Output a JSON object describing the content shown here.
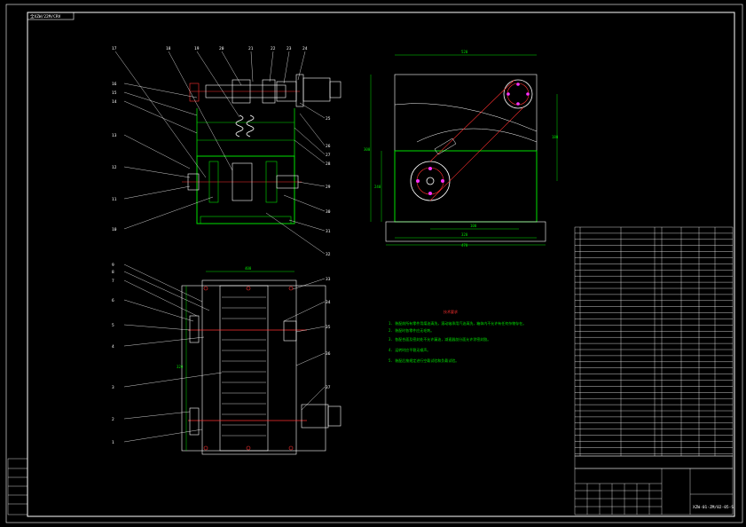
{
  "drawing": {
    "corner_code": "全XZW/22M/CRV",
    "drawing_number": "XZW-01-ZM/02-05-S",
    "callouts_top": [
      "17",
      "18",
      "19",
      "20",
      "21",
      "22",
      "23",
      "24"
    ],
    "callouts_left_front": [
      "16",
      "15",
      "14",
      "13",
      "12",
      "11",
      "10"
    ],
    "callouts_right_front": [
      "25",
      "26",
      "27",
      "28",
      "29",
      "30",
      "31",
      "32"
    ],
    "callouts_left_bottom": [
      "9",
      "8",
      "7",
      "6",
      "5",
      "4",
      "3",
      "2",
      "1"
    ],
    "callouts_right_bottom": [
      "33",
      "34",
      "35",
      "36",
      "37"
    ],
    "tech_title": "技术要求",
    "tech_notes": [
      "1. 装配前所有零件用煤油清洗，滚动轴承用汽油清洗，箱体内不允许有任何杂物存在。",
      "2. 装配时各零件应无毛刺。",
      "3. 各配合面及密封处不允许漏油，减速器剖分面允许涂密封胶。",
      "4. 运转时应平稳无噪声。",
      "5. 装配后按规定进行空载试验和负载试验。"
    ],
    "dims": {
      "top_width": "520",
      "side_height": "300",
      "left_height": "240",
      "inner_height": "180",
      "bottom_inner": "320",
      "bottom_outer": "470",
      "gear_span": "100",
      "plan_width": "400",
      "plan_height": "320"
    }
  }
}
